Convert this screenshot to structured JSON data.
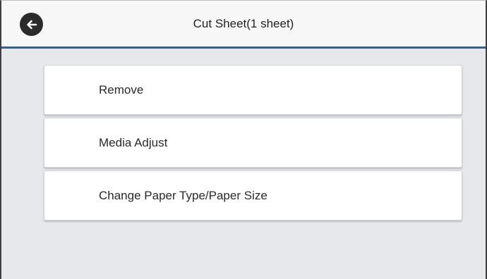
{
  "header": {
    "title": "Cut Sheet(1 sheet)",
    "back_icon": "arrow-left-icon"
  },
  "menu": {
    "items": [
      {
        "label": "Remove"
      },
      {
        "label": "Media Adjust"
      },
      {
        "label": "Change Paper Type/Paper Size"
      }
    ]
  },
  "colors": {
    "background": "#e6e8ec",
    "header_background": "#f7f7f7",
    "header_accent": "#3a5f8a",
    "back_button": "#2b2b2b"
  }
}
